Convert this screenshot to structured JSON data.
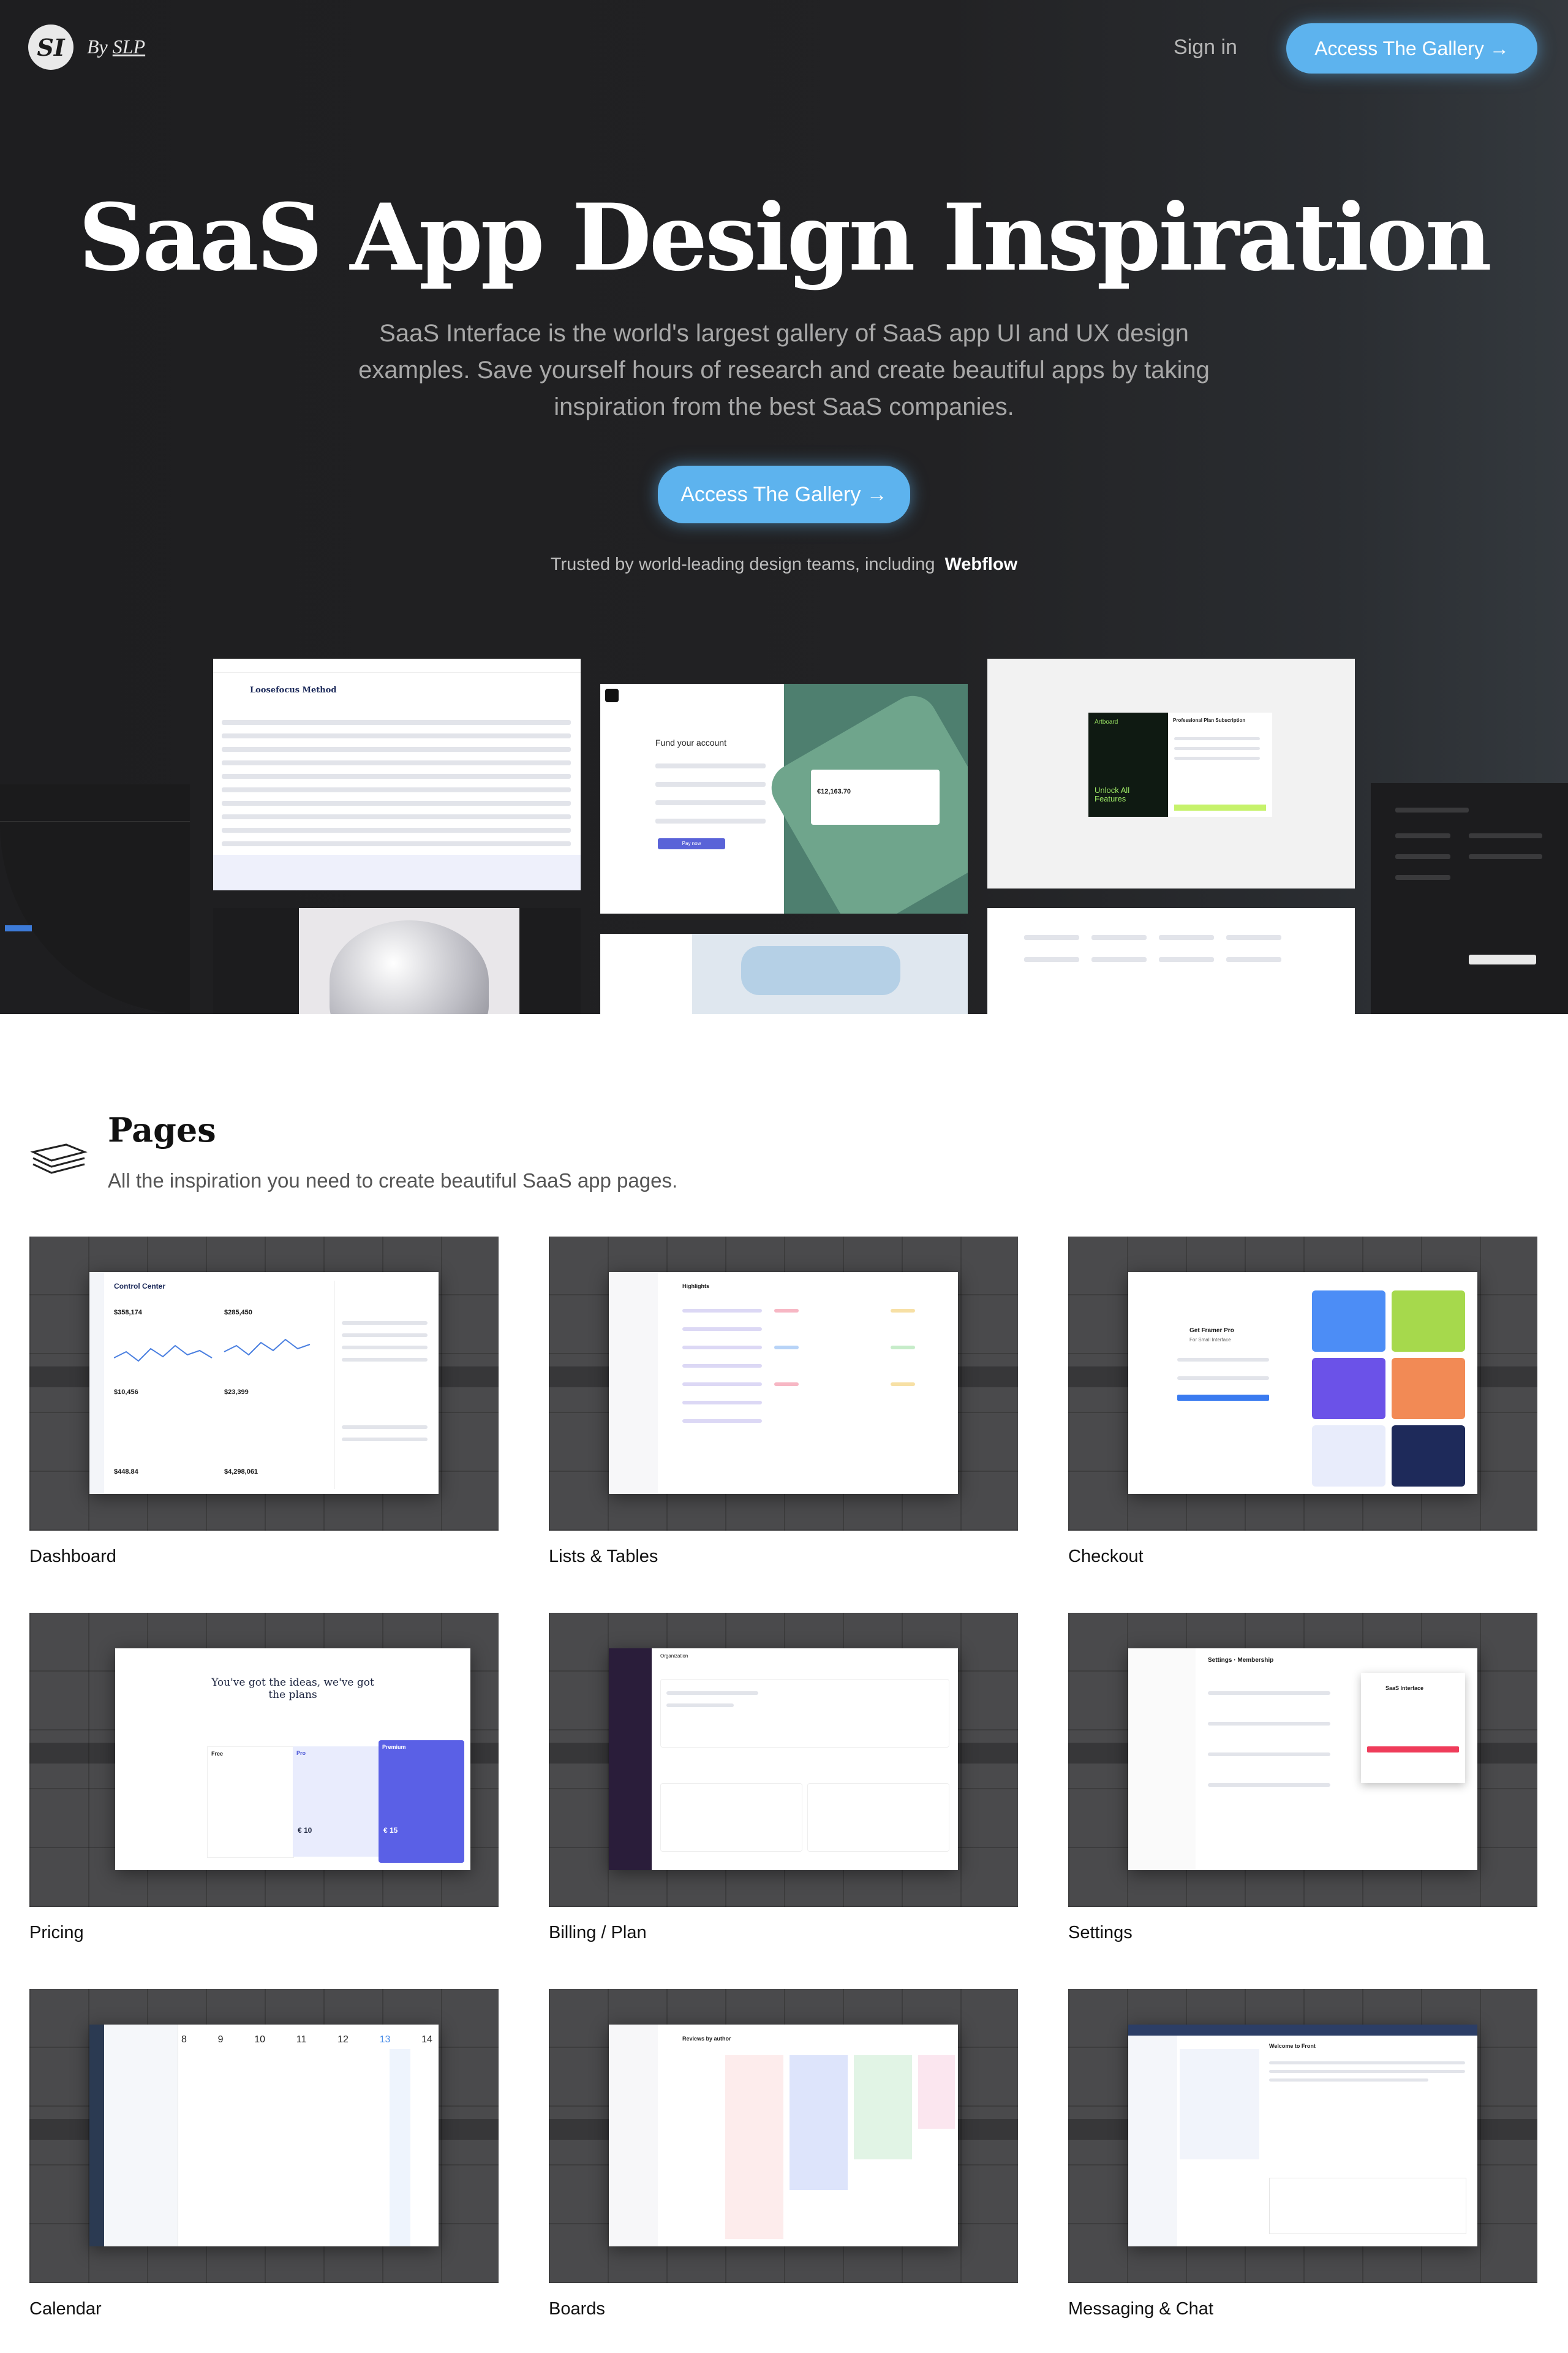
{
  "nav": {
    "logo_mark": "SI",
    "by_prefix": "By",
    "by_brand": "SLP",
    "sign_in": "Sign in",
    "cta": "Access The Gallery →"
  },
  "hero": {
    "title": "SaaS App Design Inspiration",
    "subtitle": "SaaS Interface is the world's largest gallery of SaaS app UI and UX design examples. Save yourself hours of research and create beautiful apps by taking inspiration from the best SaaS companies.",
    "cta": "Access The Gallery →",
    "trusted_text": "Trusted by world-leading design teams, including",
    "trusted_brand": "Webflow"
  },
  "showcase": {
    "table_title": "Loosefocus Method",
    "fund_title": "Fund your account",
    "fund_amount": "€12,163.70",
    "fund_button": "Pay now",
    "unlock_text": "Unlock All Features",
    "unlock_brand": "Artboard",
    "subscription_title": "Professional Plan Subscription"
  },
  "section": {
    "title": "Pages",
    "subtitle": "All the inspiration you need to create beautiful SaaS app pages."
  },
  "pages": [
    {
      "label": "Dashboard",
      "inner_title": "Control Center",
      "stats": [
        "$358,174",
        "$285,450",
        "$10,456",
        "$23,399",
        "$448.84",
        "$4,298,061"
      ]
    },
    {
      "label": "Lists & Tables",
      "inner_title": "Highlights"
    },
    {
      "label": "Checkout",
      "inner_title": "Get Framer Pro",
      "inner_sub": "For Small Interface"
    },
    {
      "label": "Pricing",
      "inner_title": "You've got the ideas, we've got the plans",
      "plan_names": [
        "Free",
        "Pro",
        "Premium"
      ],
      "plan_prices": [
        "€ 10",
        "€ 15"
      ]
    },
    {
      "label": "Billing / Plan",
      "inner_title": "Organization"
    },
    {
      "label": "Settings",
      "inner_title": "Settings · Membership",
      "modal_title": "SaaS Interface"
    },
    {
      "label": "Calendar",
      "days": [
        "8",
        "9",
        "10",
        "11",
        "12",
        "13",
        "14"
      ]
    },
    {
      "label": "Boards",
      "inner_title": "Reviews by author"
    },
    {
      "label": "Messaging & Chat",
      "inner_title": "Welcome to Front"
    }
  ],
  "colors": {
    "accent": "#5db3ee",
    "hero_bg": "#222224",
    "page_bg": "#ffffff"
  }
}
